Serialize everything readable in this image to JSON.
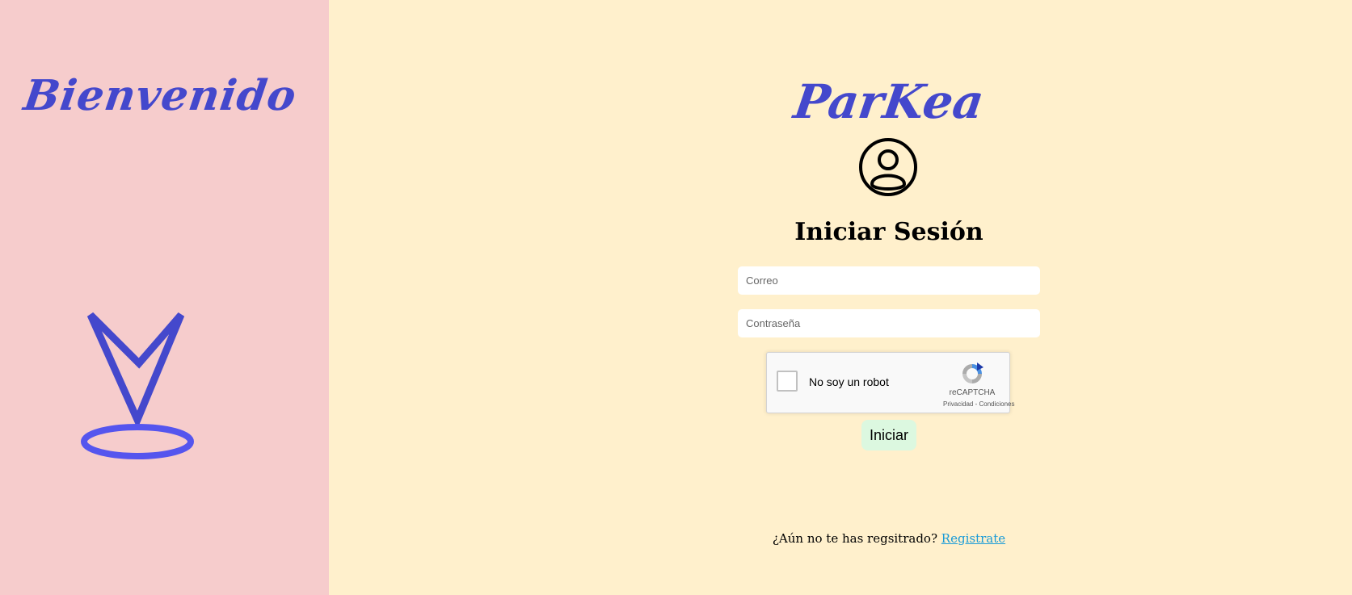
{
  "left": {
    "welcome_text": "Bienvenido"
  },
  "brand": {
    "name": "ParKea"
  },
  "form": {
    "title": "Iniciar Sesión",
    "email_placeholder": "Correo",
    "password_placeholder": "Contraseña",
    "submit_label": "Iniciar"
  },
  "captcha": {
    "label": "No soy un robot",
    "brand": "reCAPTCHA",
    "privacy": "Privacidad",
    "separator": " - ",
    "terms": "Condiciones"
  },
  "register": {
    "prompt": "¿Aún no te has regsitrado?",
    "link_label": "Registrate"
  },
  "colors": {
    "left_bg": "#f6cccc",
    "right_bg": "#fff0cc",
    "accent": "#4448cc",
    "button_bg": "#dcf8e0",
    "link": "#1a9bd7"
  },
  "icons": {
    "logo": "map-pin-logo",
    "user": "user-circle-icon",
    "captcha": "recaptcha-icon"
  }
}
